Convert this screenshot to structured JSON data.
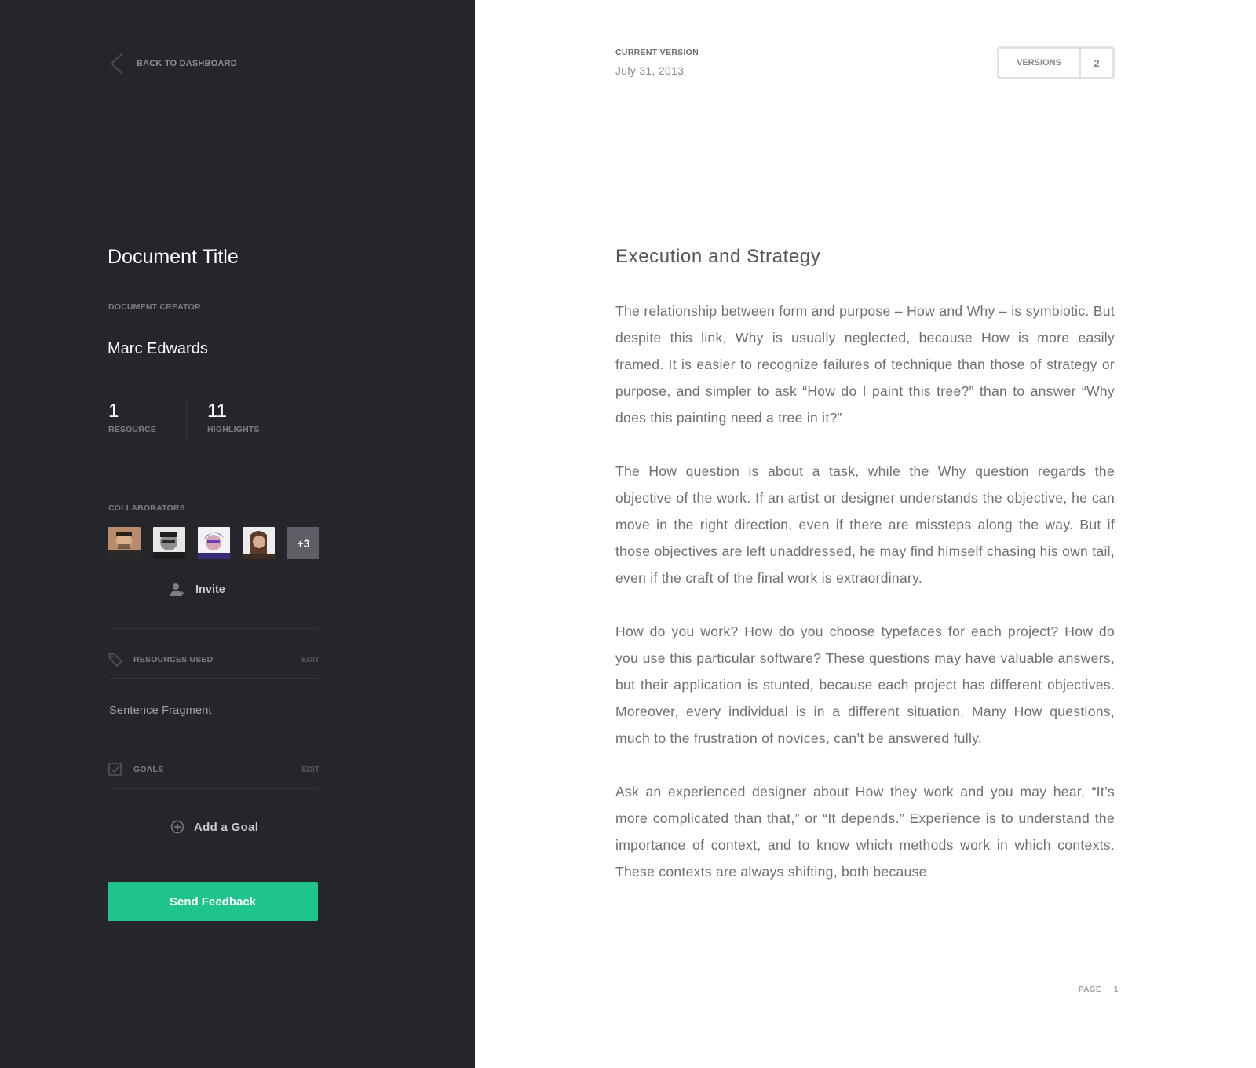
{
  "sidebar": {
    "back_label": "BACK TO DASHBOARD",
    "document_title": "Document Title",
    "creator_label": "DOCUMENT CREATOR",
    "creator_name": "Marc Edwards",
    "stats": [
      {
        "value": "1",
        "label": "RESOURCE"
      },
      {
        "value": "11",
        "label": "HIGHLIGHTS"
      }
    ],
    "collaborators_label": "COLLABORATORS",
    "collaborators_more": "+3",
    "invite_label": "Invite",
    "resources_label": "RESOURCES USED",
    "resources_edit": "EDIT",
    "resource_item": "Sentence Fragment",
    "goals_label": "GOALS",
    "goals_edit": "EDIT",
    "add_goal_label": "Add a Goal",
    "send_feedback_label": "Send Feedback"
  },
  "header": {
    "current_version_label": "CURRENT VERSION",
    "current_version_date": "July 31, 2013",
    "versions_label": "VERSIONS",
    "versions_count": "2"
  },
  "article": {
    "heading": "Execution and Strategy",
    "paragraphs": [
      "The relationship between form and purpose – How and Why – is symbiotic. But despite this link, Why is usually neglected, because How is more easily framed. It is easier to recognize failures of technique than those of strategy or purpose, and simpler to ask “How do I paint this tree?” than to answer “Why does this painting need a tree in it?”",
      "The How question is about a task, while the Why question regards the objective of the work. If an artist or designer understands the objective, he can move in the right direction, even if there are missteps along the way. But if those objectives are left unaddressed, he may find himself chasing his own tail, even if the craft of the final work is extraordinary.",
      "How do you work? How do you choose typefaces for each project? How do you use this particular software? These questions may have valuable answers, but their application is stunted, because each project has different objectives. Moreover, every individual is in a different situation. Many How questions, much to the frustration of novices, can’t be answered fully.",
      "Ask an experienced designer about How they work and you may hear, “It’s more complicated than that,” or “It depends.” Experience is to understand the importance of context, and to know which methods work in which contexts. These contexts are always shifting, both because"
    ]
  },
  "footer": {
    "page_label": "PAGE",
    "page_number": "1"
  },
  "colors": {
    "sidebar_bg": "#25262b",
    "accent_green": "#1fc38c",
    "text_body": "#6e6e73"
  },
  "icons": [
    "chevron-left-icon",
    "add-user-icon",
    "tag-icon",
    "checkbox-icon",
    "plus-circle-icon"
  ]
}
